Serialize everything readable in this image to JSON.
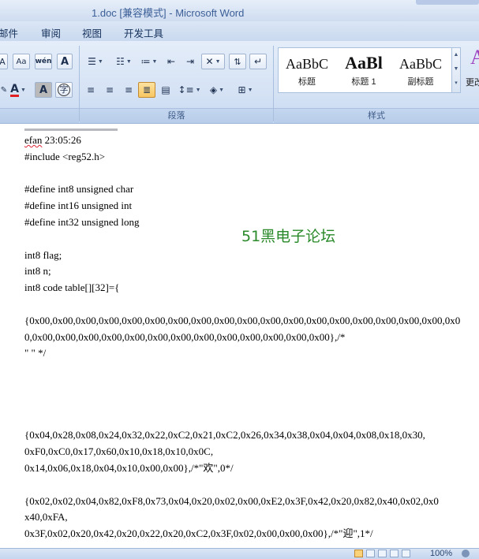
{
  "window": {
    "title": "1.doc [兼容模式] - Microsoft Word"
  },
  "ribbon_tabs": {
    "mailings": "邮件",
    "review": "审阅",
    "view": "视图",
    "developer": "开发工具"
  },
  "paragraph_group": {
    "label": "段落"
  },
  "styles_group": {
    "label": "样式",
    "items": [
      {
        "sample": "AaBbC",
        "name": "标题"
      },
      {
        "sample": "AaBl",
        "name": "标题 1"
      },
      {
        "sample": "AaBbC",
        "name": "副标题"
      }
    ],
    "change_styles_label": "更改"
  },
  "font_group": {
    "text_highlight_label": "A",
    "font_color_label": "A",
    "char_shading_label": "A",
    "enclose_char_label": "字",
    "change_case_label": "Aa",
    "phonetic_label": "wén"
  },
  "document": {
    "lines": [
      "efan 23:05:26",
      "#include <reg52.h>",
      "",
      "#define int8 unsigned char",
      "#define int16 unsigned int",
      "#define int32 unsigned long",
      "",
      "int8 flag;",
      "int8 n;",
      "int8 code table[][32]={",
      "",
      "{0x00,0x00,0x00,0x00,0x00,0x00,0x00,0x00,0x00,0x00,0x00,0x00,0x00,0x00,0x00,0x00,0x00,0x00,0x00,0x00,0x00,0x00,0x00,0x00,0x00,0x00,0x00,0x00,0x00,0x00,0x00,0x00},/*",
      "\"    \" */",
      "",
      "",
      "",
      "",
      "{0x04,0x28,0x08,0x24,0x32,0x22,0xC2,0x21,0xC2,0x26,0x34,0x38,0x04,0x04,0x08,0x18,0x30,",
      "0xF0,0xC0,0x17,0x60,0x10,0x18,0x10,0x0C,",
      "0x14,0x06,0x18,0x04,0x10,0x00,0x00},/*\"欢\",0*/",
      "",
      "{0x02,0x02,0x04,0x82,0xF8,0x73,0x04,0x20,0x02,0x00,0xE2,0x3F,0x42,0x20,0x82,0x40,0x02,0x0",
      "x40,0xFA,",
      "0x3F,0x02,0x20,0x42,0x20,0x22,0x20,0xC2,0x3F,0x02,0x00,0x00,0x00},/*\"迎\",1*/"
    ],
    "watermark": "51黑电子论坛"
  },
  "status_bar": {
    "zoom": "100%"
  },
  "colors": {
    "font_color_red": "#e02020",
    "highlight_yellow": "#f8c660",
    "watermark_green": "#2a8a2a"
  }
}
